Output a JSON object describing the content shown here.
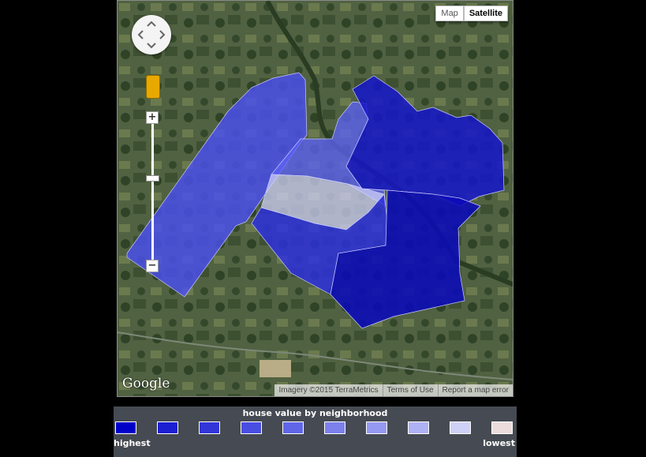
{
  "map": {
    "type_buttons": {
      "map": "Map",
      "satellite": "Satellite"
    },
    "selected_type": "Satellite",
    "zoom_in": "+",
    "zoom_out": "−",
    "logo": "Google",
    "attribution": {
      "imagery": "Imagery ©2015 TerraMetrics",
      "terms": "Terms of Use",
      "report": "Report a map error"
    },
    "regions": [
      {
        "name": "northwest-strip",
        "color": "#4a4ff0",
        "opacity": 0.82
      },
      {
        "name": "north-center",
        "color": "#5c62f3",
        "opacity": 0.78
      },
      {
        "name": "center-light",
        "color": "#cfd0f7",
        "opacity": 0.75
      },
      {
        "name": "center-south",
        "color": "#2c2fe0",
        "opacity": 0.82
      },
      {
        "name": "northeast",
        "color": "#1616c8",
        "opacity": 0.86
      },
      {
        "name": "southeast",
        "color": "#0a0ab8",
        "opacity": 0.88
      }
    ]
  },
  "legend": {
    "title": "house value by neighborhood",
    "highest_label": "highest",
    "lowest_label": "lowest",
    "colors": [
      "#0000c8",
      "#1c1fd1",
      "#3236d9",
      "#494ee2",
      "#6166e8",
      "#7b80ed",
      "#9599f1",
      "#aeb1f4",
      "#cfd0f7",
      "#ecdcdc"
    ]
  }
}
